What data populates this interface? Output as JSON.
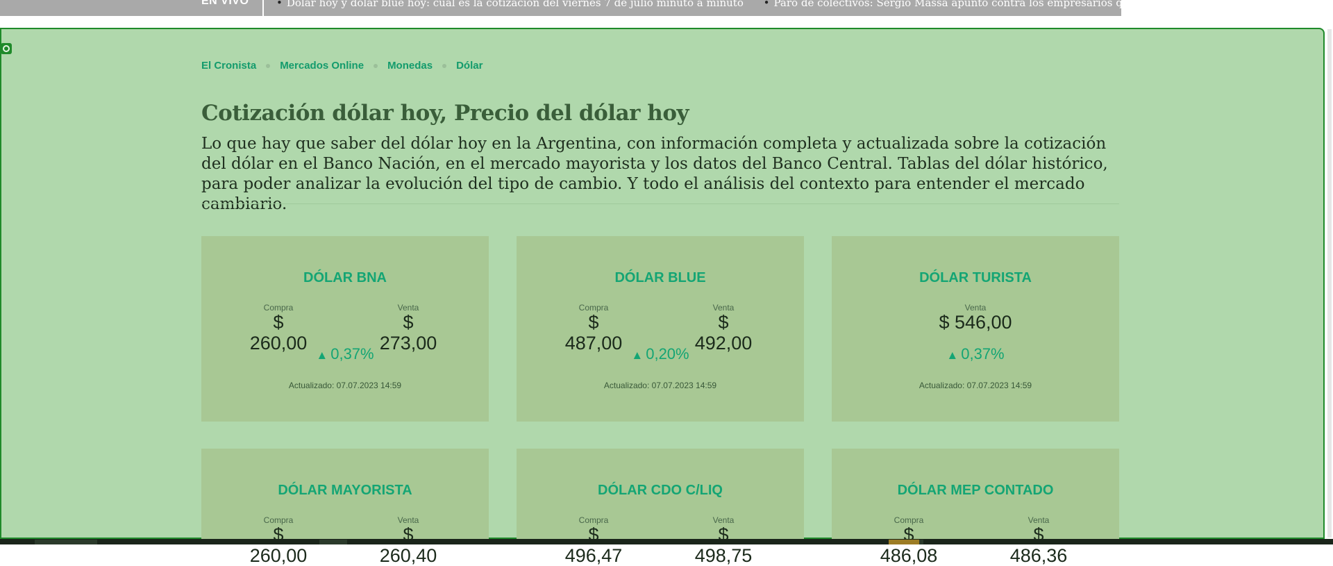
{
  "ticker": {
    "label": "EN VIVO",
    "items": [
      "Dólar hoy y dólar blue hoy: cuál es la cotización del viernes 7 de julio minuto a minuto",
      "Paro de colectivos: Sergio Massa apuntó contra los empresarios que \"no pr"
    ]
  },
  "breadcrumb": [
    "El Cronista",
    "Mercados Online",
    "Monedas",
    "Dólar"
  ],
  "header": {
    "title": "Cotización dólar hoy, Precio del dólar hoy",
    "description": "Lo que hay que saber del dólar hoy en la Argentina, con información completa y actualizada sobre la cotización del dólar en el Banco Nación, en el mercado mayorista y los datos del Banco Central. Tablas del dólar histórico, para poder analizar la evolución del tipo de cambio. Y todo el análisis del contexto para entender el mercado cambiario."
  },
  "cards": [
    {
      "name": "DÓLAR BNA",
      "compra_label": "Compra",
      "compra": "$ 260,00",
      "venta_label": "Venta",
      "venta": "$ 273,00",
      "variation": "0,37%",
      "updated": "Actualizado: 07.07.2023 14:59"
    },
    {
      "name": "DÓLAR BLUE",
      "compra_label": "Compra",
      "compra": "$ 487,00",
      "venta_label": "Venta",
      "venta": "$ 492,00",
      "variation": "0,20%",
      "updated": "Actualizado: 07.07.2023 14:59"
    },
    {
      "name": "DÓLAR TURISTA",
      "venta_label": "Venta",
      "venta": "$ 546,00",
      "variation": "0,37%",
      "updated": "Actualizado: 07.07.2023 14:59"
    },
    {
      "name": "DÓLAR MAYORISTA",
      "compra_label": "Compra",
      "compra": "$ 260,00",
      "venta_label": "Venta",
      "venta": "$ 260,40"
    },
    {
      "name": "DÓLAR CDO C/LIQ",
      "compra_label": "Compra",
      "compra": "$ 496,47",
      "venta_label": "Venta",
      "venta": "$ 498,75"
    },
    {
      "name": "DÓLAR MEP CONTADO",
      "compra_label": "Compra",
      "compra": "$ 486,08",
      "venta_label": "Venta",
      "venta": "$ 486,36"
    }
  ],
  "icons": {
    "variation": "triangle-up-icon",
    "overlay": "target-icon"
  },
  "colors": {
    "accent": "#14a574",
    "overlay": "#b0d8ac",
    "card": "#a8c894",
    "border": "#1f8a2a"
  }
}
